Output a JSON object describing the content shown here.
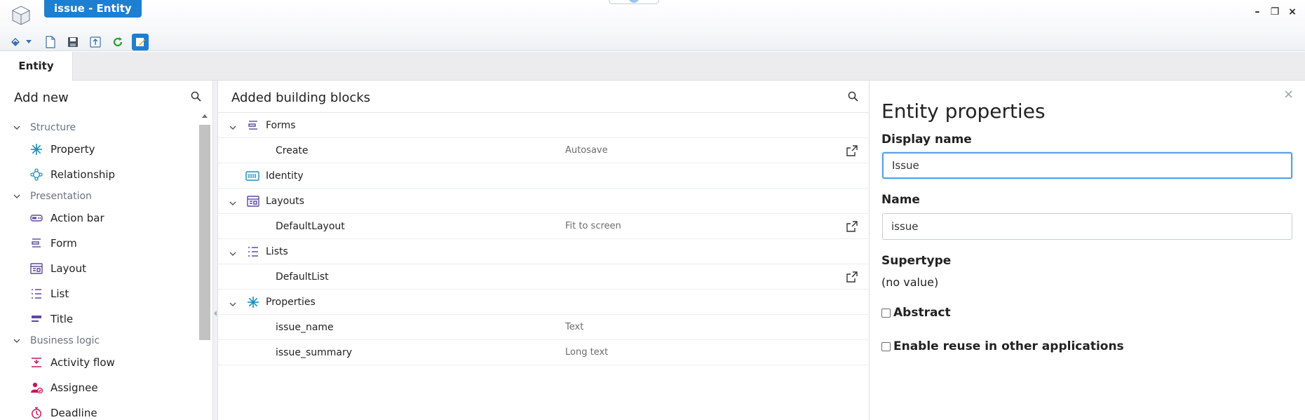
{
  "window": {
    "title": "issue - Entity",
    "controls": {
      "minimize": "–",
      "restore": "❐",
      "close": "×"
    }
  },
  "toolbar": {
    "icons": [
      "back-icon",
      "dropdown-icon",
      "new-document-icon",
      "save-icon",
      "export-icon",
      "refresh-icon",
      "edit-icon"
    ]
  },
  "tabs": [
    {
      "label": "Entity",
      "active": true
    }
  ],
  "add_new": {
    "title": "Add new",
    "groups": [
      {
        "label": "Structure",
        "items": [
          {
            "label": "Property",
            "icon": "property-icon"
          },
          {
            "label": "Relationship",
            "icon": "relationship-icon"
          }
        ]
      },
      {
        "label": "Presentation",
        "items": [
          {
            "label": "Action bar",
            "icon": "action-bar-icon"
          },
          {
            "label": "Form",
            "icon": "form-icon"
          },
          {
            "label": "Layout",
            "icon": "layout-icon"
          },
          {
            "label": "List",
            "icon": "list-icon"
          },
          {
            "label": "Title",
            "icon": "title-icon"
          }
        ]
      },
      {
        "label": "Business logic",
        "items": [
          {
            "label": "Activity flow",
            "icon": "activity-flow-icon"
          },
          {
            "label": "Assignee",
            "icon": "assignee-icon"
          },
          {
            "label": "Deadline",
            "icon": "deadline-icon"
          }
        ]
      }
    ]
  },
  "building_blocks": {
    "title": "Added building blocks",
    "rows": [
      {
        "label": "Forms",
        "value": "",
        "type": "group"
      },
      {
        "label": "Create",
        "value": "Autosave",
        "type": "child"
      },
      {
        "label": "Identity",
        "value": "",
        "type": "single"
      },
      {
        "label": "Layouts",
        "value": "",
        "type": "group"
      },
      {
        "label": "DefaultLayout",
        "value": "Fit to screen",
        "type": "child"
      },
      {
        "label": "Lists",
        "value": "",
        "type": "group"
      },
      {
        "label": "DefaultList",
        "value": "",
        "type": "child"
      },
      {
        "label": "Properties",
        "value": "",
        "type": "group"
      },
      {
        "label": "issue_name",
        "value": "Text",
        "type": "child"
      },
      {
        "label": "issue_summary",
        "value": "Long text",
        "type": "child"
      }
    ]
  },
  "properties": {
    "title": "Entity properties",
    "display_name_label": "Display name",
    "display_name_value": "Issue",
    "name_label": "Name",
    "name_value": "issue",
    "supertype_label": "Supertype",
    "supertype_value": "(no value)",
    "abstract_label": "Abstract",
    "abstract_checked": false,
    "reuse_label": "Enable reuse in other applications",
    "reuse_checked": false
  },
  "colors": {
    "accent": "#1e7fd0",
    "purple_icon": "#5b4aa0",
    "teal_icon": "#1a8fc0",
    "pink_icon": "#c2185b"
  }
}
